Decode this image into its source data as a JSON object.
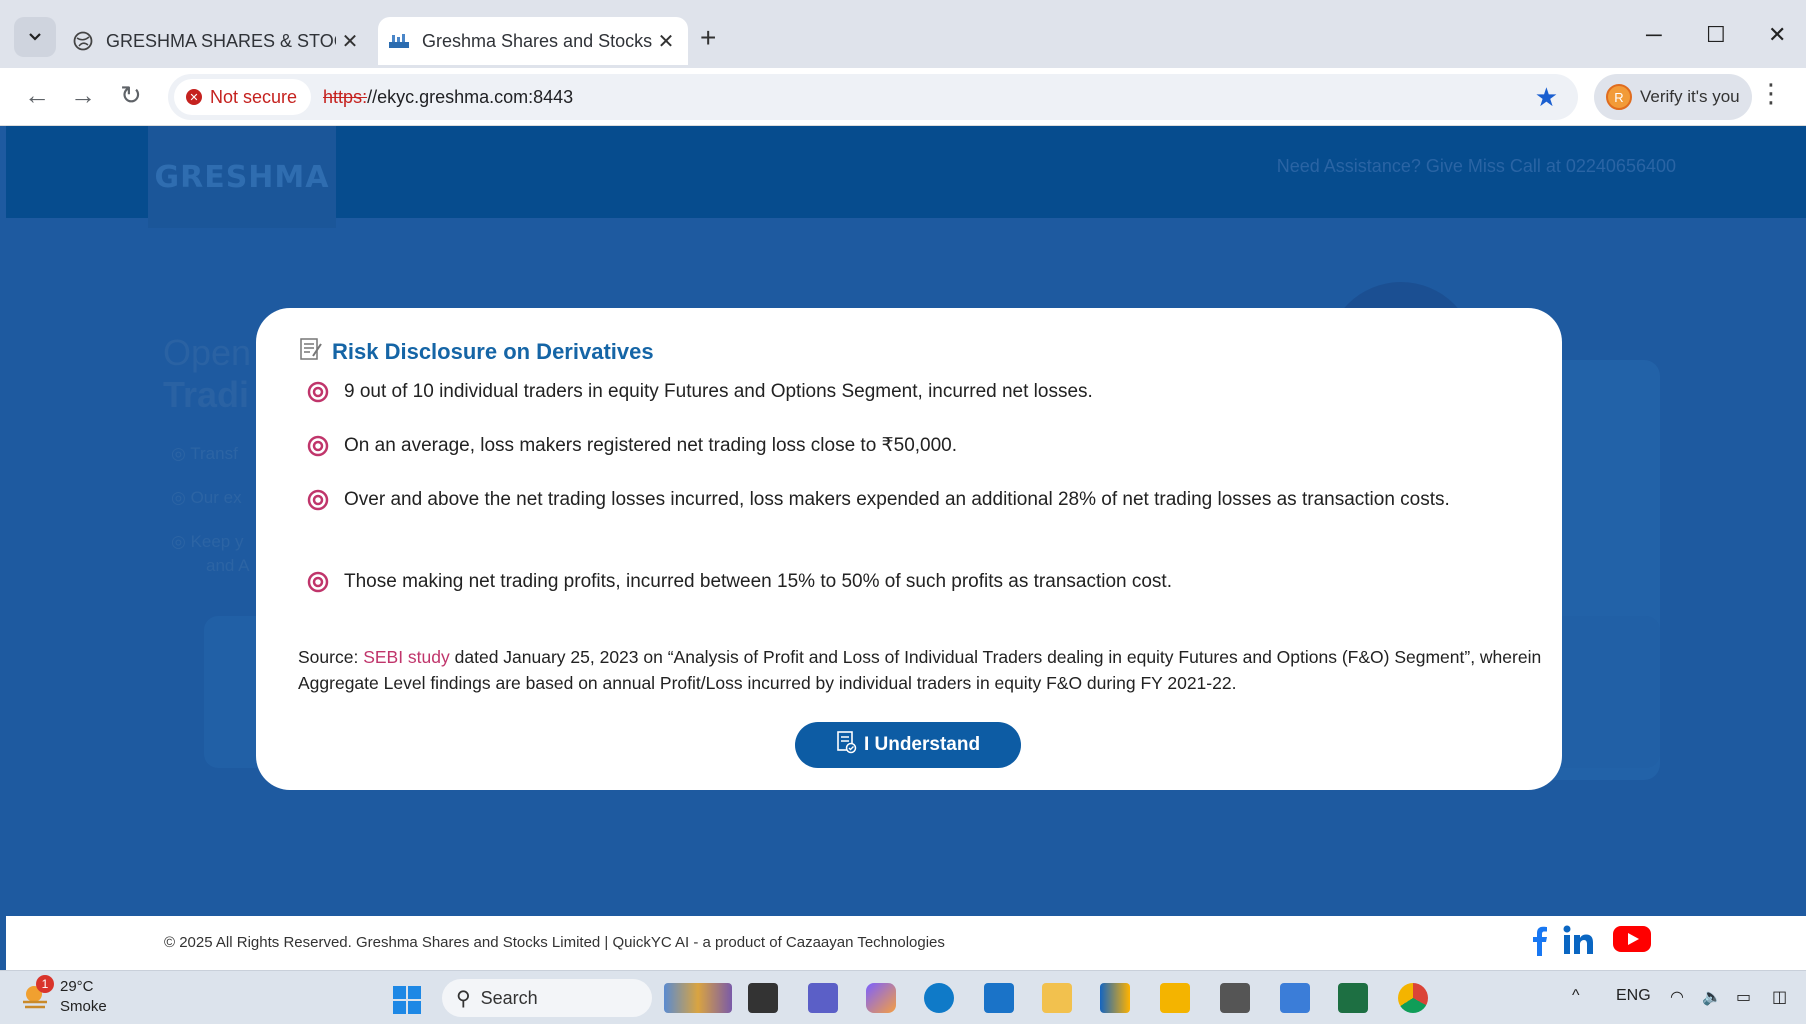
{
  "browser": {
    "tabs": [
      {
        "title": "GRESHMA SHARES & STOCKS L",
        "active": false
      },
      {
        "title": "Greshma Shares and Stocks Lim",
        "active": true
      }
    ],
    "security_label": "Not secure",
    "url_scheme": "https:",
    "url_rest": "//ekyc.greshma.com:8443",
    "verify_label": "Verify it's you",
    "profile_initial": "R"
  },
  "site": {
    "logo": "GRESHMA",
    "assistance": "Need Assistance? Give Miss Call at 02240656400",
    "hero_line1": "Open",
    "hero_line2": "Tradi",
    "bullets": [
      "Transf",
      "Our ex",
      "Keep y",
      "and A"
    ]
  },
  "modal": {
    "title": "Risk Disclosure on Derivatives",
    "points": [
      "9 out of 10 individual traders in equity Futures and Options Segment, incurred net losses.",
      "On an average, loss makers registered net trading loss close to ₹50,000.",
      "Over and above the net trading losses incurred, loss makers expended an additional 28% of net trading losses as transaction costs.",
      "Those making net trading profits, incurred between 15% to 50% of such profits as transaction cost."
    ],
    "source_prefix": "Source: ",
    "source_link": "SEBI study",
    "source_text": " dated January 25, 2023 on “Analysis of Profit and Loss of Individual Traders dealing in equity Futures and Options (F&O) Segment”, wherein Aggregate Level findings are based on annual Profit/Loss incurred by individual traders in equity F&O during FY 2021-22.",
    "button_label": "I Understand",
    "accent_color": "#1565a6",
    "bullet_color": "#c0356b"
  },
  "footer": {
    "text": "© 2025 All Rights Reserved. Greshma Shares and Stocks Limited | QuickYC AI - a product of Cazaayan Technologies",
    "social": [
      "facebook-icon",
      "linkedin-icon",
      "youtube-icon"
    ]
  },
  "taskbar": {
    "temperature": "29°C",
    "condition": "Smoke",
    "notification_count": "1",
    "search_label": "Search",
    "language": "ENG"
  }
}
